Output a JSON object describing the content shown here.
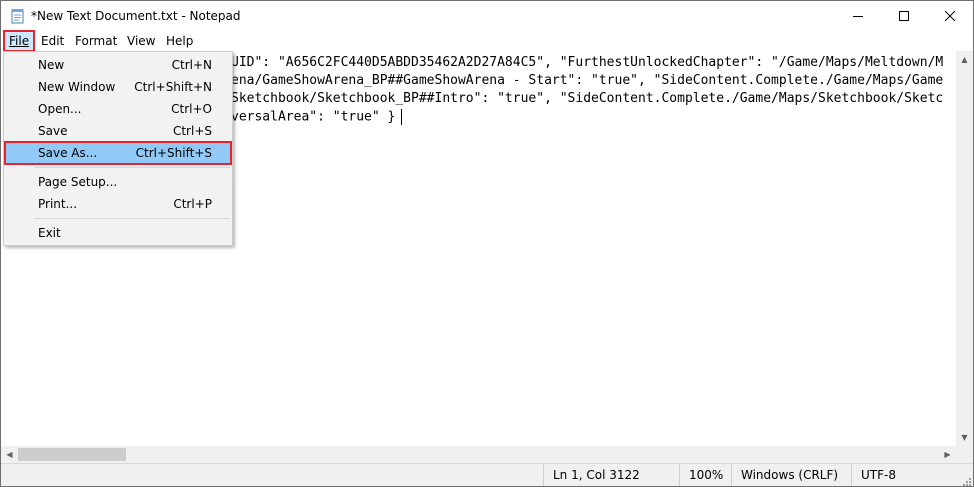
{
  "window": {
    "title": "*New Text Document.txt - Notepad",
    "controls": [
      "minimize-icon",
      "maximize-icon",
      "close-icon"
    ]
  },
  "menubar": {
    "file": "File",
    "edit": "Edit",
    "format": "Format",
    "view": "View",
    "help": "Help"
  },
  "file_menu": {
    "items": [
      {
        "label": "New",
        "shortcut": "Ctrl+N"
      },
      {
        "label": "New Window",
        "shortcut": "Ctrl+Shift+N"
      },
      {
        "label": "Open...",
        "shortcut": "Ctrl+O"
      },
      {
        "label": "Save",
        "shortcut": "Ctrl+S"
      },
      {
        "label": "Save As...",
        "shortcut": "Ctrl+Shift+S",
        "highlighted": true
      },
      {
        "label": "Page Setup...",
        "shortcut": ""
      },
      {
        "label": "Print...",
        "shortcut": "Ctrl+P"
      },
      {
        "label": "Exit",
        "shortcut": ""
      }
    ]
  },
  "editor": {
    "lines": [
      "UID\": \"A656C2FC440D5ABDD35462A2D27A84C5\", \"FurthestUnlockedChapter\": \"/Game/Maps/Meltdown/M",
      "ena/GameShowArena_BP##GameShowArena - Start\": \"true\", \"SideContent.Complete./Game/Maps/Game",
      "Sketchbook/Sketchbook_BP##Intro\": \"true\", \"SideContent.Complete./Game/Maps/Sketchbook/Sketc",
      "versalArea\": \"true\" }"
    ]
  },
  "statusbar": {
    "position": "Ln 1, Col 3122",
    "zoom": "100%",
    "line_endings": "Windows (CRLF)",
    "encoding": "UTF-8"
  },
  "colors": {
    "highlight_outline": "#e8242a",
    "menu_hover": "#91c9f7",
    "menu_bg": "#f2f2f2",
    "status_bg": "#f0f0f0"
  }
}
